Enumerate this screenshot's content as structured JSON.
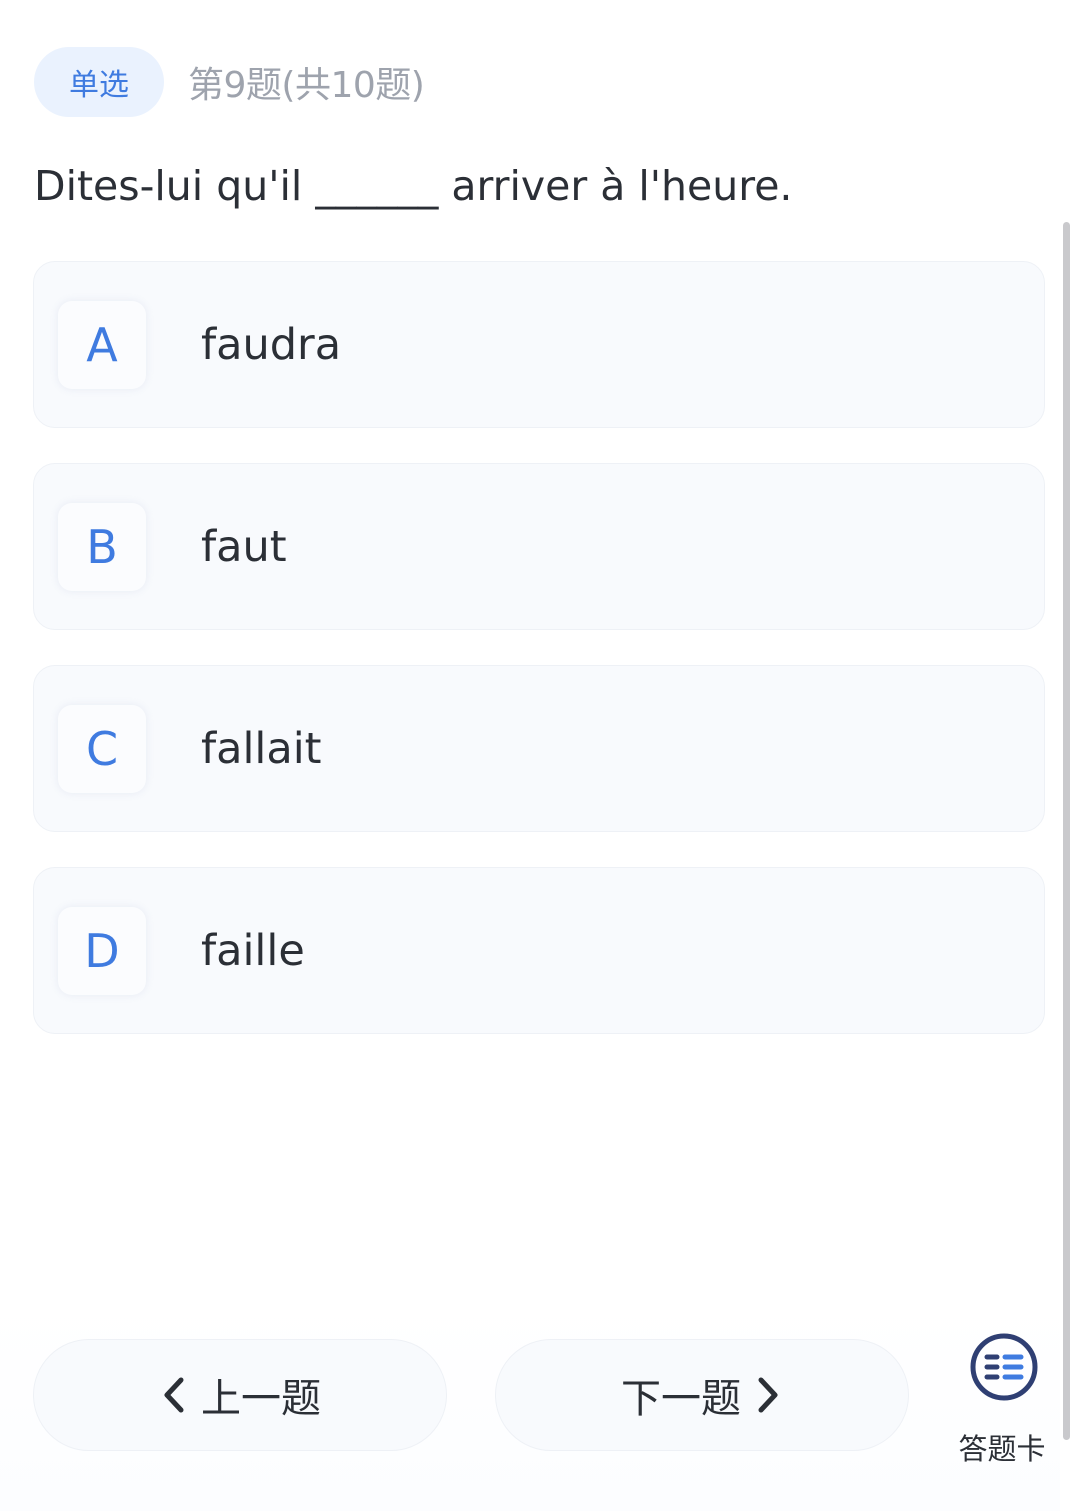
{
  "header": {
    "type_badge": "单选",
    "progress": "第9题(共10题)"
  },
  "question": {
    "text": "Dites-lui qu'il ______ arriver à l'heure."
  },
  "options": [
    {
      "letter": "A",
      "text": "faudra"
    },
    {
      "letter": "B",
      "text": "faut"
    },
    {
      "letter": "C",
      "text": "fallait"
    },
    {
      "letter": "D",
      "text": "faille"
    }
  ],
  "footer": {
    "prev_label": "上一题",
    "next_label": "下一题",
    "answer_sheet_label": "答题卡",
    "prev_icon": "chevron-left-icon",
    "next_icon": "chevron-right-icon",
    "answer_sheet_icon": "list-icon"
  },
  "colors": {
    "accent": "#3f7be0",
    "badge_bg": "#eaf2fe",
    "card_bg": "#f8fafd",
    "muted_text": "#9ea3ad",
    "icon_navy": "#2f3f73"
  }
}
